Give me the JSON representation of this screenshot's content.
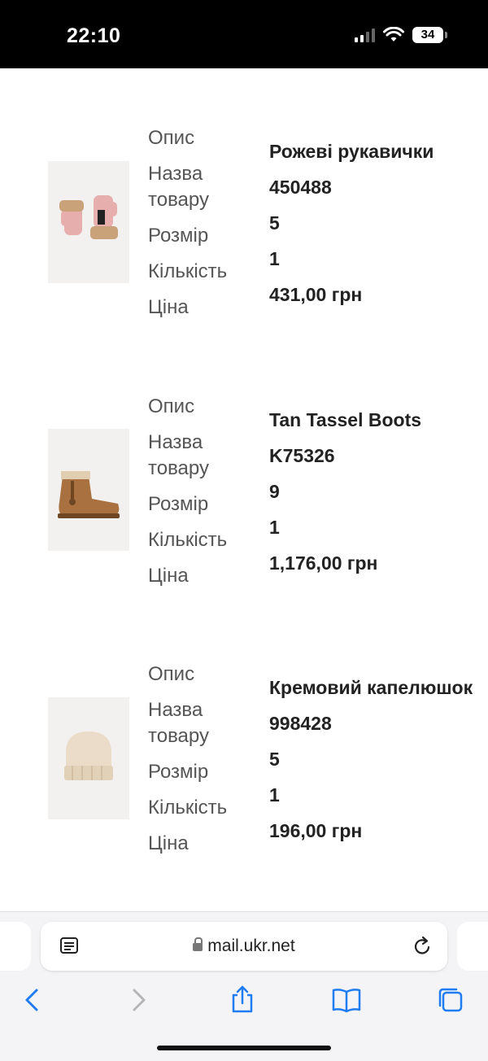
{
  "status": {
    "time": "22:10",
    "battery": "34"
  },
  "labels": {
    "description": "Опис",
    "name_line1": "Назва",
    "name_line2": "товару",
    "size": "Розмір",
    "quantity": "Кількість",
    "price": "Ціна"
  },
  "items": [
    {
      "description": "Рожеві рукавички",
      "code": "450488",
      "size": "5",
      "quantity": "1",
      "price": "431,00 грн",
      "image": "pink-gloves"
    },
    {
      "description": "Tan Tassel Boots",
      "code": "K75326",
      "size": "9",
      "quantity": "1",
      "price": "1,176,00 грн",
      "image": "tan-boots"
    },
    {
      "description": "Кремовий капелюшок",
      "code": "998428",
      "size": "5",
      "quantity": "1",
      "price": "196,00 грн",
      "image": "cream-hat"
    }
  ],
  "browser": {
    "url": "mail.ukr.net",
    "icons": [
      "reader-icon",
      "lock-icon",
      "reload-icon",
      "back-icon",
      "forward-icon",
      "share-icon",
      "bookmarks-icon",
      "tabs-icon"
    ]
  },
  "colors": {
    "accent": "#1f7cf2",
    "disabled": "#b5b5b8"
  }
}
